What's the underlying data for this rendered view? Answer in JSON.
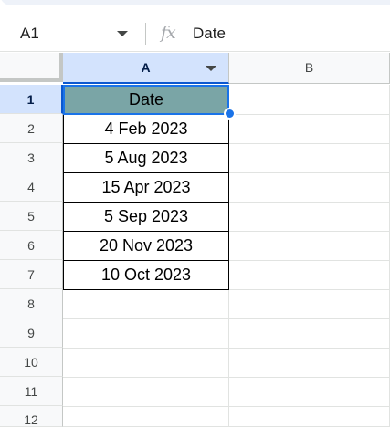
{
  "formula_bar": {
    "name_box": "A1",
    "fx_label": "fx",
    "value": "Date"
  },
  "columns": [
    {
      "label": "A",
      "selected": true
    },
    {
      "label": "B",
      "selected": false
    }
  ],
  "rows": [
    "1",
    "2",
    "3",
    "4",
    "5",
    "6",
    "7",
    "8",
    "9",
    "10",
    "11",
    "12"
  ],
  "cells": {
    "A1": "Date",
    "A2": "4 Feb 2023",
    "A3": "5 Aug 2023",
    "A4": "15 Apr 2023",
    "A5": "5 Sep 2023",
    "A6": "20 Nov 2023",
    "A7": "10 Oct 2023"
  },
  "colors": {
    "header_fill": "#7aa5a6",
    "selection_accent": "#1a73e8",
    "selected_header_bg": "#d3e3fd"
  }
}
